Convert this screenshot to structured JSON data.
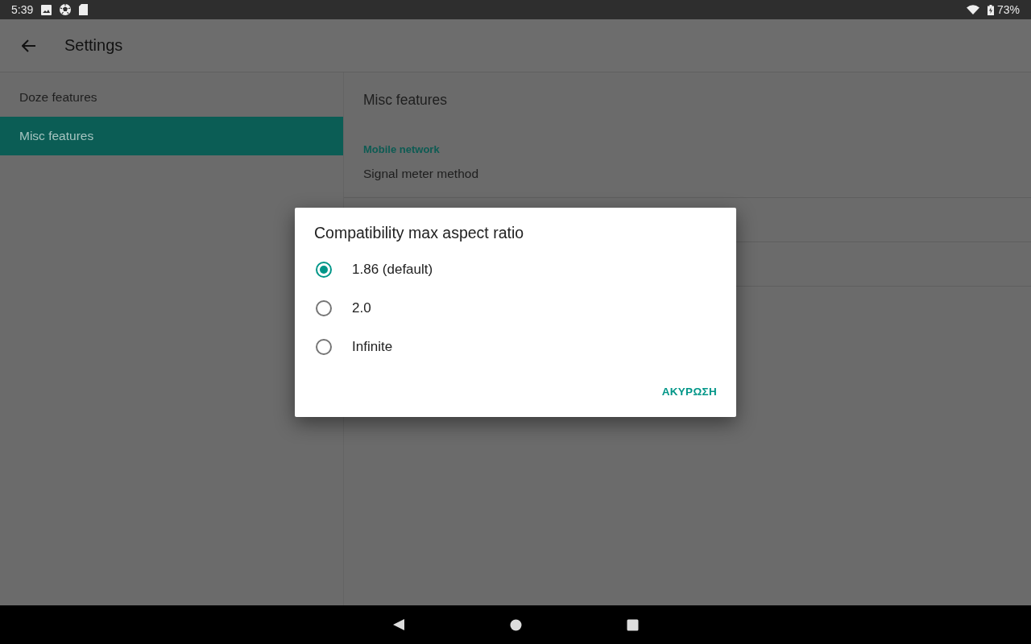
{
  "status_bar": {
    "time": "5:39",
    "battery": "73%"
  },
  "app_bar": {
    "title": "Settings"
  },
  "sidebar": {
    "items": [
      {
        "label": "Doze features",
        "selected": false
      },
      {
        "label": "Misc features",
        "selected": true
      }
    ]
  },
  "content": {
    "title": "Misc features",
    "category": "Mobile network",
    "preferences": [
      {
        "title": "Signal meter method"
      }
    ]
  },
  "dialog": {
    "title": "Compatibility max aspect ratio",
    "options": [
      {
        "label": "1.86 (default)",
        "selected": true
      },
      {
        "label": "2.0",
        "selected": false
      },
      {
        "label": "Infinite",
        "selected": false
      }
    ],
    "buttons": [
      "ΑΚΥΡΩΣΗ"
    ]
  }
}
